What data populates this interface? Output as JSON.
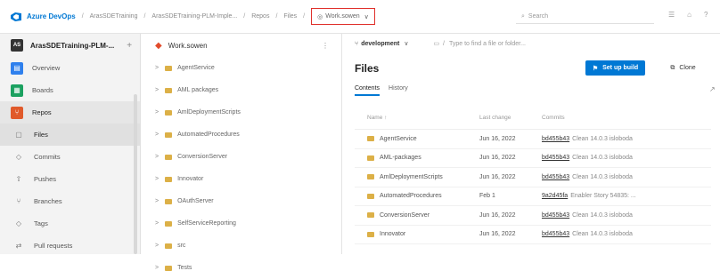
{
  "topbar": {
    "brand": "Azure DevOps",
    "breadcrumbs": [
      "ArasSDETraining",
      "ArasSDETraining-PLM-Imple...",
      "Repos",
      "Files"
    ],
    "active_crumb": "Work.sowen",
    "search_placeholder": "Search"
  },
  "leftnav": {
    "project": "ArasSDETraining-PLM-...",
    "project_initials": "AS",
    "items": [
      {
        "label": "Overview",
        "icon": "overview-icon",
        "color": "#2f80ed"
      },
      {
        "label": "Boards",
        "icon": "boards-icon",
        "color": "#1ba160"
      },
      {
        "label": "Repos",
        "icon": "repos-icon",
        "color": "#e05a2b"
      },
      {
        "label": "Files",
        "icon": "files-icon"
      },
      {
        "label": "Commits",
        "icon": "commits-icon"
      },
      {
        "label": "Pushes",
        "icon": "pushes-icon"
      },
      {
        "label": "Branches",
        "icon": "branches-icon"
      },
      {
        "label": "Tags",
        "icon": "tags-icon"
      },
      {
        "label": "Pull requests",
        "icon": "pull-requests-icon"
      }
    ]
  },
  "tree": {
    "repo_name": "Work.sowen",
    "items": [
      {
        "label": "AgentService"
      },
      {
        "label": "AML packages"
      },
      {
        "label": "AmlDeploymentScripts"
      },
      {
        "label": "AutomatedProcedures"
      },
      {
        "label": "ConversionServer"
      },
      {
        "label": "Innovator"
      },
      {
        "label": "OAuthServer"
      },
      {
        "label": "SelfServiceReporting"
      },
      {
        "label": "src"
      },
      {
        "label": "Tests"
      }
    ]
  },
  "main": {
    "branch": "development",
    "path_placeholder": "Type to find a file or folder...",
    "title": "Files",
    "setup_build": "Set up build",
    "clone": "Clone",
    "tabs": [
      "Contents",
      "History"
    ],
    "columns": [
      "Name ↑",
      "Last change",
      "Commits"
    ],
    "rows": [
      {
        "name": "AgentService",
        "last_change": "Jun 16, 2022",
        "hash": "bd455b43",
        "message": "Clean 14.0.3 isloboda"
      },
      {
        "name": "AML-packages",
        "last_change": "Jun 16, 2022",
        "hash": "bd455b43",
        "message": "Clean 14.0.3 isloboda"
      },
      {
        "name": "AmlDeploymentScripts",
        "last_change": "Jun 16, 2022",
        "hash": "bd455b43",
        "message": "Clean 14.0.3 isloboda"
      },
      {
        "name": "AutomatedProcedures",
        "last_change": "Feb 1",
        "hash": "9a2d45fa",
        "message": "Enabler Story 54835: ..."
      },
      {
        "name": "ConversionServer",
        "last_change": "Jun 16, 2022",
        "hash": "bd455b43",
        "message": "Clean 14.0.3 isloboda"
      },
      {
        "name": "Innovator",
        "last_change": "Jun 16, 2022",
        "hash": "bd455b43",
        "message": "Clean 14.0.3 isloboda"
      }
    ]
  }
}
